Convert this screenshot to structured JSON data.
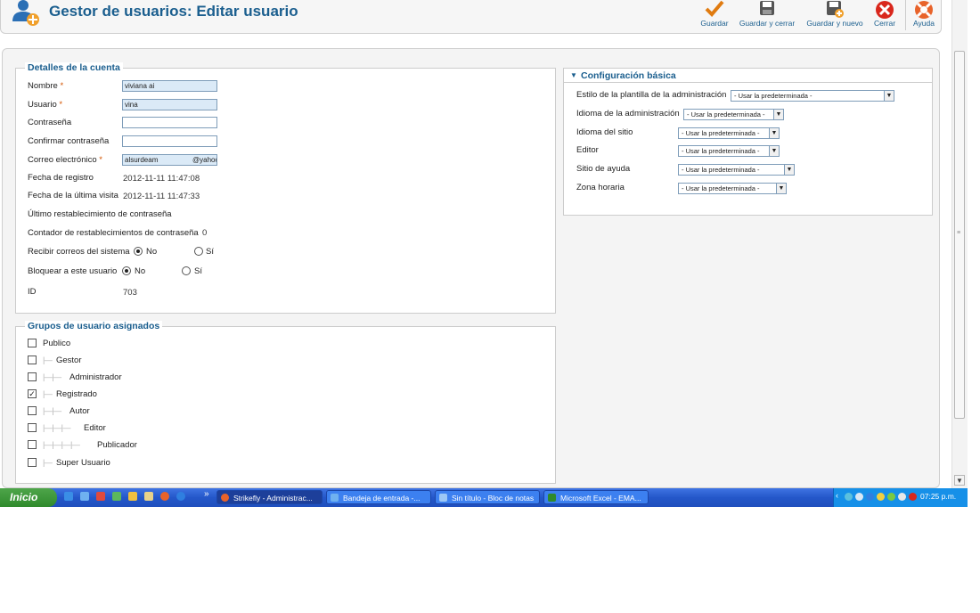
{
  "header": {
    "title": "Gestor de usuarios: Editar usuario",
    "toolbar": [
      {
        "label": "Guardar",
        "icon": "checkmark-icon"
      },
      {
        "label": "Guardar y cerrar",
        "icon": "save-icon"
      },
      {
        "label": "Guardar y nuevo",
        "icon": "save-new-icon"
      },
      {
        "label": "Cerrar",
        "icon": "close-icon"
      },
      {
        "label": "Ayuda",
        "icon": "help-lifebuoy-icon"
      }
    ]
  },
  "account": {
    "legend": "Detalles de la cuenta",
    "nombre": {
      "label": "Nombre",
      "required": "*",
      "value": "viviana ai"
    },
    "usuario": {
      "label": "Usuario",
      "required": "*",
      "value": "vina"
    },
    "contrasena": {
      "label": "Contraseña",
      "value": ""
    },
    "confirmar": {
      "label": "Confirmar contraseña",
      "value": ""
    },
    "correo": {
      "label": "Correo electrónico",
      "required": "*",
      "value": "alsurdeam",
      "value_tail": "@yahoo"
    },
    "fecha_registro": {
      "label": "Fecha de registro",
      "value": "2012-11-11 11:47:08"
    },
    "fecha_visita": {
      "label": "Fecha de la última visita",
      "value": "2012-11-11 11:47:33"
    },
    "ultimo_restablecimiento": {
      "label": "Último restablecimiento de contraseña"
    },
    "contador": {
      "label": "Contador de restablecimientos de contraseña",
      "value": "0"
    },
    "recibir": {
      "label": "Recibir correos del sistema",
      "no": "No",
      "si": "Sí",
      "selected": "No"
    },
    "bloquear": {
      "label": "Bloquear a este usuario",
      "no": "No",
      "si": "Sí",
      "selected": "No"
    },
    "id": {
      "label": "ID",
      "value": "703"
    }
  },
  "groups": {
    "legend": "Grupos de usuario asignados",
    "items": [
      {
        "label": "Publico",
        "checked": false,
        "prefix": ""
      },
      {
        "label": "Gestor",
        "checked": false,
        "prefix": "|—"
      },
      {
        "label": "Administrador",
        "checked": false,
        "prefix": "|—|—"
      },
      {
        "label": "Registrado",
        "checked": true,
        "prefix": "|—"
      },
      {
        "label": "Autor",
        "checked": false,
        "prefix": "|—|—"
      },
      {
        "label": "Editor",
        "checked": false,
        "prefix": "|—|—|—"
      },
      {
        "label": "Publicador",
        "checked": false,
        "prefix": "|—|—|—|—"
      },
      {
        "label": "Super Usuario",
        "checked": false,
        "prefix": "|—"
      }
    ]
  },
  "config": {
    "title": "Configuración básica",
    "rows": [
      {
        "label": "Estilo de la plantilla de la administración",
        "value": "- Usar la predeterminada -"
      },
      {
        "label": "Idioma de la administración",
        "value": "- Usar la predeterminada -"
      },
      {
        "label": "Idioma del sitio",
        "value": "- Usar la predeterminada -"
      },
      {
        "label": "Editor",
        "value": "- Usar la predeterminada -"
      },
      {
        "label": "Sitio de ayuda",
        "value": "- Usar la predeterminada -"
      },
      {
        "label": "Zona horaria",
        "value": "- Usar la predeterminada -"
      }
    ]
  },
  "taskbar": {
    "start": "Inicio",
    "buttons": [
      {
        "label": "Strikefly - Administrac...",
        "active": true
      },
      {
        "label": "Bandeja de entrada -...",
        "active": false
      },
      {
        "label": "Sin título - Bloc de notas",
        "active": false
      },
      {
        "label": "Microsoft Excel - EMA...",
        "active": false
      }
    ],
    "more": "»",
    "clock": "07:25 p.m."
  },
  "colors": {
    "accent": "#1a5e8e",
    "required": "#d35400",
    "taskbar": "#2457c9",
    "start": "#2f8a2c"
  }
}
